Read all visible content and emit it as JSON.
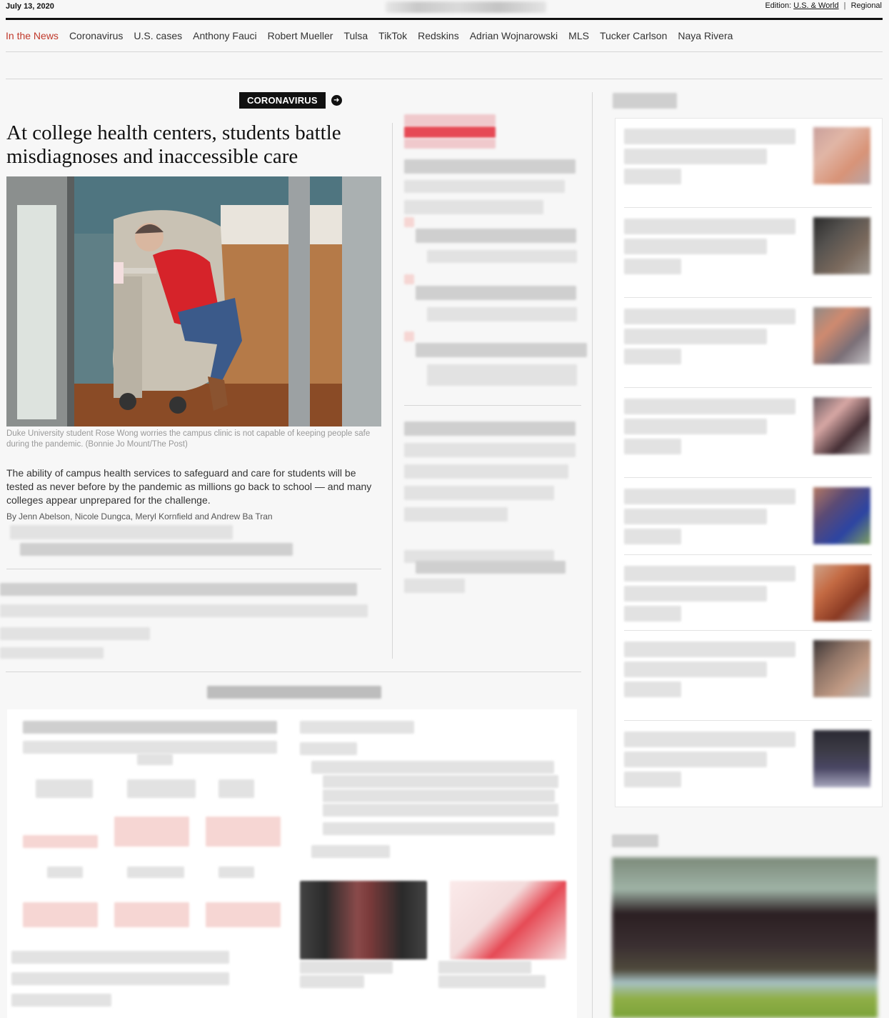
{
  "top_bar": {
    "date": "July 13, 2020",
    "edition_label": "Edition:",
    "edition_selected": "U.S. & World",
    "edition_separator": "|",
    "edition_alt": "Regional"
  },
  "nav": {
    "items": [
      "In the News",
      "Coronavirus",
      "U.S. cases",
      "Anthony Fauci",
      "Robert Mueller",
      "Tulsa",
      "TikTok",
      "Redskins",
      "Adrian Wojnarowski",
      "MLS",
      "Tucker Carlson",
      "Naya Rivera"
    ]
  },
  "lead_story": {
    "kicker": "CORONAVIRUS",
    "headline": "At college health centers, students battle misdiagnoses and inaccessible care",
    "caption": "Duke University student Rose Wong worries the campus clinic is not capable of keeping people safe during the pandemic. (Bonnie Jo Mount/The Post)",
    "blurb": "The ability of campus health services to safeguard and care for students will be tested as never before by the pandemic as millions go back to school — and many colleges appear unprepared for the challenge.",
    "byline_prefix": "By",
    "byline_authors": "Jenn Abelson, Nicole Dungca, Meryl Kornfield and Andrew Ba Tran"
  },
  "colors": {
    "accent_red": "#c0392b",
    "kicker_bg": "#111111",
    "page_bg": "#f7f7f7"
  },
  "icons": {
    "kicker_arrow": "arrow-circle-right-icon"
  }
}
